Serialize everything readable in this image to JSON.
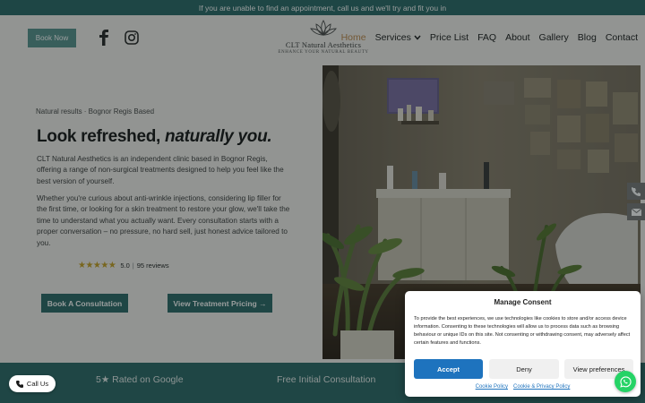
{
  "topbar": {
    "text": "If you are unable to find an appointment, call us and we'll try and fit you in"
  },
  "header": {
    "book_now": "Book Now",
    "logo_name": "CLT Natural Aesthetics",
    "logo_tagline": "ENHANCE YOUR NATURAL BEAUTY",
    "nav": [
      "Home",
      "Services",
      "Price List",
      "FAQ",
      "About",
      "Gallery",
      "Blog",
      "Contact"
    ],
    "active_nav": "Home",
    "icons": [
      "facebook-icon",
      "instagram-icon",
      "chevron-down-icon"
    ]
  },
  "hero": {
    "eyebrow": "Natural results · Bognor Regis Based",
    "headline_plain": "Look refreshed, ",
    "headline_italic": "naturally you.",
    "para1": "CLT Natural Aesthetics is an independent clinic based in Bognor Regis, offering a range of non-surgical treatments designed to help you feel like the best version of yourself.",
    "para2": "Whether you're curious about anti-wrinkle injections, considering lip filler for the first time, or looking for a skin treatment to restore your glow, we'll take the time to understand what you actually want. Every consultation starts with a proper conversation – no pressure, no hard sell, just honest advice tailored to you.",
    "stars": "★★★★★",
    "rating_value": "5.0",
    "rating_sep": "|",
    "rating_count": "95 reviews",
    "btn_consult": "Book A Consultation",
    "btn_pricing": "View Treatment Pricing →"
  },
  "strip": {
    "item1": "5★ Rated on Google",
    "item2": "Free Initial Consultation"
  },
  "call_button": "Call Us",
  "consent": {
    "title": "Manage Consent",
    "body": "To provide the best experiences, we use technologies like cookies to store and/or access device information. Consenting to these technologies will allow us to process data such as browsing behaviour or unique IDs on this site. Not consenting or withdrawing consent, may adversely affect certain features and functions.",
    "accept": "Accept",
    "deny": "Deny",
    "preferences": "View preferences",
    "cookie_policy": "Cookie Policy",
    "privacy_policy": "Cookie & Privacy Policy"
  },
  "colors": {
    "brand_teal": "#2f6b69",
    "accent_gold": "#c08a4e",
    "accept_blue": "#1e73be",
    "whatsapp_green": "#25d366"
  }
}
